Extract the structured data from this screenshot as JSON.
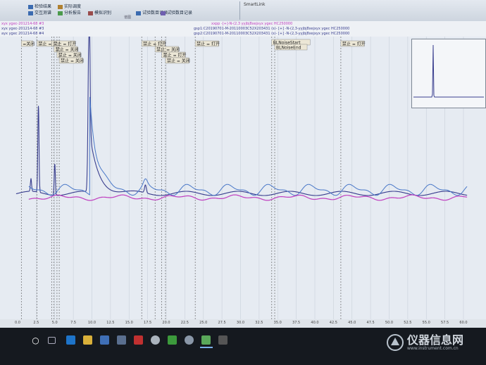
{
  "ribbon": {
    "items": [
      "",
      "",
      " ",
      "",
      "",
      ""
    ],
    "labels": [
      "检验结果",
      "交互测谱",
      "实际调度",
      "分析报告",
      "模拟识别",
      "试验数目记录"
    ],
    "group_label": "谱图",
    "smartlink": "SmartLink"
  },
  "legend": {
    "left1": "xyx ygec-201214-68 #3",
    "left2": "ayx ygec 201214-68 #4",
    "right1": "gsp1:C20190701-M-20110003C52X203431 (s)- [+] -N-(2,3-yyjbj8xejxyx ygec HC250000",
    "right2": "gsp2:C20190701-M-20110003C52X203431 (s)- [+] -N-(2,3-yyjbj8xejxyx ygec HC250000",
    "top_pink": "xxpp -[+]-N-(2,3 yyjbj8xejxyx ygec HC250000"
  },
  "events": [
    {
      "label": "=关闭"
    },
    {
      "label": "禁止 = 关闭"
    },
    {
      "label": "禁止 = 打开"
    },
    {
      "label": "禁止 = 关闭"
    },
    {
      "label": "禁止 = 关闭"
    },
    {
      "label": "禁止 = 关闭"
    },
    {
      "label": "禁止 = 打开"
    },
    {
      "label": "禁止 = 关闭"
    },
    {
      "label": "禁止 = 打开"
    },
    {
      "label": "禁止 = 关闭"
    },
    {
      "label": "禁止 = 打开"
    },
    {
      "label": "BLNoiseStart"
    },
    {
      "label": "BLNoiseEnd"
    },
    {
      "label": "禁止 = 打开"
    }
  ],
  "chart_data": {
    "type": "line",
    "x_ticks": [
      "0.0",
      "2.5",
      "5.0",
      "7.5",
      "10.0",
      "12.5",
      "15.0",
      "17.5",
      "20.0",
      "22.5",
      "25.0",
      "27.5",
      "30.0",
      "32.5",
      "35.0",
      "37.5",
      "40.0",
      "42.5",
      "45.0",
      "47.5",
      "50.0",
      "52.5",
      "55.0",
      "57.5",
      "60.0"
    ],
    "xlim": [
      0,
      60
    ],
    "series": [
      {
        "color": "#3a3f8f",
        "peaks": [
          {
            "x": 1.8,
            "y": 0.08
          },
          {
            "x": 2.8,
            "y": 0.55
          },
          {
            "x": 5.0,
            "y": 0.2
          },
          {
            "x": 9.6,
            "y": 1.0
          },
          {
            "x": 17.2,
            "y": 0.05
          }
        ]
      },
      {
        "color": "#4a78c8"
      },
      {
        "color": "#c040c0"
      }
    ]
  },
  "watermark": {
    "title": "仪器信息网",
    "url": "www.instrument.com.cn"
  },
  "colors": {
    "trace_dark": "#3a3f8f",
    "trace_blue": "#4a78c8",
    "trace_magenta": "#c040c0",
    "event_box": "#ece7d6"
  }
}
